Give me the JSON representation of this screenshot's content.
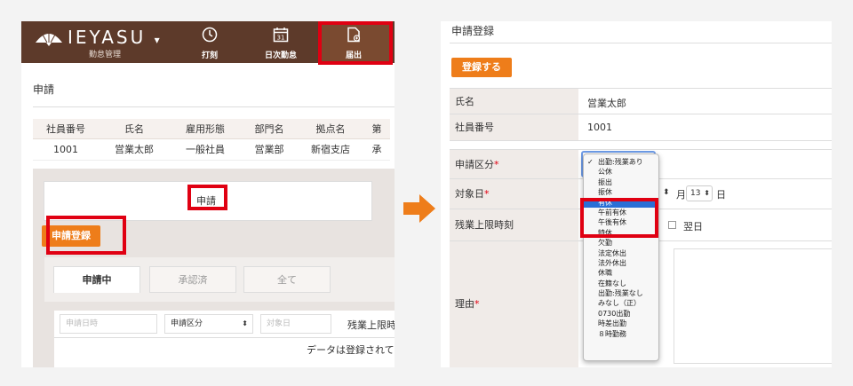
{
  "left": {
    "brand": {
      "name": "IEYASU",
      "caret": "▾",
      "subtitle": "勤怠管理"
    },
    "nav": [
      {
        "label": "打刻",
        "icon": "clock-icon"
      },
      {
        "label": "日次勤怠",
        "icon": "calendar-icon",
        "day": "31"
      },
      {
        "label": "届出",
        "icon": "document-icon"
      }
    ],
    "section_title": "申請",
    "employee_table": {
      "headers": [
        "社員番号",
        "氏名",
        "雇用形態",
        "部門名",
        "拠点名",
        "第"
      ],
      "row": [
        "1001",
        "営業太郎",
        "一般社員",
        "営業部",
        "新宿支店",
        "承"
      ]
    },
    "tab_label": "申請",
    "register_button": "申請登録",
    "subtabs": [
      "申請中",
      "承認済",
      "全て"
    ],
    "filters": {
      "date_placeholder": "申請日時",
      "category_select": "申請区分",
      "target_placeholder": "対象日",
      "overtime_label": "残業上限時"
    },
    "empty_message": "データは登録されて"
  },
  "right": {
    "title": "申請登録",
    "register_button": "登録する",
    "fields": {
      "name_label": "氏名",
      "name_value": "営業太郎",
      "id_label": "社員番号",
      "id_value": "1001",
      "category_label": "申請区分",
      "required_mark": "*",
      "target_label": "対象日",
      "month_suffix": "月",
      "day_value": "13",
      "day_suffix": "日",
      "overtime_label": "残業上限時刻",
      "next_day": "翌日",
      "reason_label": "理由"
    },
    "dropdown_options": [
      "出勤:残業あり",
      "公休",
      "振出",
      "振休",
      "有休",
      "午前有休",
      "午後有休",
      "特休",
      "欠勤",
      "法定休出",
      "法外休出",
      "休職",
      "在籍なし",
      "出勤:残業なし",
      "みなし（正）",
      "0730出勤",
      "時差出勤",
      "８時勤務"
    ],
    "checked_option": "出勤:残業あり",
    "highlighted_option": "有休"
  },
  "colors": {
    "header": "#5d3a2a",
    "accent": "#ee7d1a",
    "highlight": "#e00012",
    "select": "#2a6fd6"
  }
}
